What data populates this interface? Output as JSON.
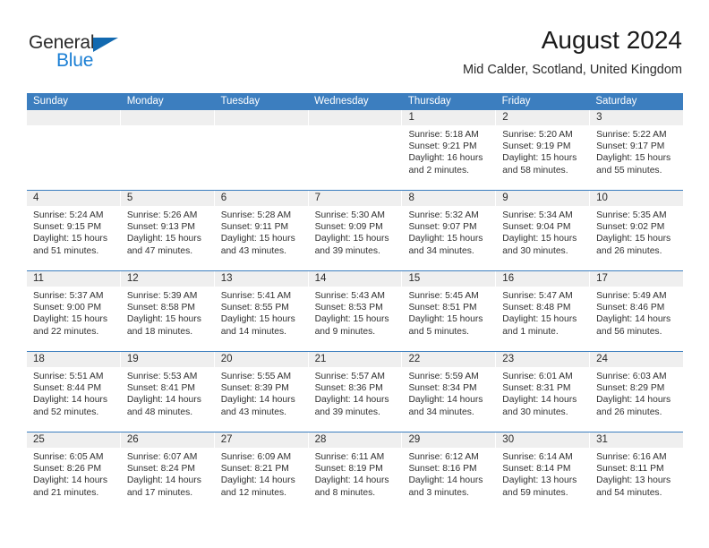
{
  "brand": {
    "name_top": "General",
    "name_bottom": "Blue",
    "triangle_color": "#1269b0",
    "blue_color": "#1b7fd4"
  },
  "header": {
    "title": "August 2024",
    "subtitle": "Mid Calder, Scotland, United Kingdom"
  },
  "theme": {
    "header_blue": "#3c7ebf",
    "day_band_gray": "#efefef",
    "text": "#303030"
  },
  "weekdays": [
    "Sunday",
    "Monday",
    "Tuesday",
    "Wednesday",
    "Thursday",
    "Friday",
    "Saturday"
  ],
  "weeks": [
    [
      {
        "day": "",
        "sunrise": "",
        "sunset": "",
        "daylight_line1": "",
        "daylight_line2": "",
        "empty": true
      },
      {
        "day": "",
        "sunrise": "",
        "sunset": "",
        "daylight_line1": "",
        "daylight_line2": "",
        "empty": true
      },
      {
        "day": "",
        "sunrise": "",
        "sunset": "",
        "daylight_line1": "",
        "daylight_line2": "",
        "empty": true
      },
      {
        "day": "",
        "sunrise": "",
        "sunset": "",
        "daylight_line1": "",
        "daylight_line2": "",
        "empty": true
      },
      {
        "day": "1",
        "sunrise": "Sunrise: 5:18 AM",
        "sunset": "Sunset: 9:21 PM",
        "daylight_line1": "Daylight: 16 hours",
        "daylight_line2": "and 2 minutes."
      },
      {
        "day": "2",
        "sunrise": "Sunrise: 5:20 AM",
        "sunset": "Sunset: 9:19 PM",
        "daylight_line1": "Daylight: 15 hours",
        "daylight_line2": "and 58 minutes."
      },
      {
        "day": "3",
        "sunrise": "Sunrise: 5:22 AM",
        "sunset": "Sunset: 9:17 PM",
        "daylight_line1": "Daylight: 15 hours",
        "daylight_line2": "and 55 minutes."
      }
    ],
    [
      {
        "day": "4",
        "sunrise": "Sunrise: 5:24 AM",
        "sunset": "Sunset: 9:15 PM",
        "daylight_line1": "Daylight: 15 hours",
        "daylight_line2": "and 51 minutes."
      },
      {
        "day": "5",
        "sunrise": "Sunrise: 5:26 AM",
        "sunset": "Sunset: 9:13 PM",
        "daylight_line1": "Daylight: 15 hours",
        "daylight_line2": "and 47 minutes."
      },
      {
        "day": "6",
        "sunrise": "Sunrise: 5:28 AM",
        "sunset": "Sunset: 9:11 PM",
        "daylight_line1": "Daylight: 15 hours",
        "daylight_line2": "and 43 minutes."
      },
      {
        "day": "7",
        "sunrise": "Sunrise: 5:30 AM",
        "sunset": "Sunset: 9:09 PM",
        "daylight_line1": "Daylight: 15 hours",
        "daylight_line2": "and 39 minutes."
      },
      {
        "day": "8",
        "sunrise": "Sunrise: 5:32 AM",
        "sunset": "Sunset: 9:07 PM",
        "daylight_line1": "Daylight: 15 hours",
        "daylight_line2": "and 34 minutes."
      },
      {
        "day": "9",
        "sunrise": "Sunrise: 5:34 AM",
        "sunset": "Sunset: 9:04 PM",
        "daylight_line1": "Daylight: 15 hours",
        "daylight_line2": "and 30 minutes."
      },
      {
        "day": "10",
        "sunrise": "Sunrise: 5:35 AM",
        "sunset": "Sunset: 9:02 PM",
        "daylight_line1": "Daylight: 15 hours",
        "daylight_line2": "and 26 minutes."
      }
    ],
    [
      {
        "day": "11",
        "sunrise": "Sunrise: 5:37 AM",
        "sunset": "Sunset: 9:00 PM",
        "daylight_line1": "Daylight: 15 hours",
        "daylight_line2": "and 22 minutes."
      },
      {
        "day": "12",
        "sunrise": "Sunrise: 5:39 AM",
        "sunset": "Sunset: 8:58 PM",
        "daylight_line1": "Daylight: 15 hours",
        "daylight_line2": "and 18 minutes."
      },
      {
        "day": "13",
        "sunrise": "Sunrise: 5:41 AM",
        "sunset": "Sunset: 8:55 PM",
        "daylight_line1": "Daylight: 15 hours",
        "daylight_line2": "and 14 minutes."
      },
      {
        "day": "14",
        "sunrise": "Sunrise: 5:43 AM",
        "sunset": "Sunset: 8:53 PM",
        "daylight_line1": "Daylight: 15 hours",
        "daylight_line2": "and 9 minutes."
      },
      {
        "day": "15",
        "sunrise": "Sunrise: 5:45 AM",
        "sunset": "Sunset: 8:51 PM",
        "daylight_line1": "Daylight: 15 hours",
        "daylight_line2": "and 5 minutes."
      },
      {
        "day": "16",
        "sunrise": "Sunrise: 5:47 AM",
        "sunset": "Sunset: 8:48 PM",
        "daylight_line1": "Daylight: 15 hours",
        "daylight_line2": "and 1 minute."
      },
      {
        "day": "17",
        "sunrise": "Sunrise: 5:49 AM",
        "sunset": "Sunset: 8:46 PM",
        "daylight_line1": "Daylight: 14 hours",
        "daylight_line2": "and 56 minutes."
      }
    ],
    [
      {
        "day": "18",
        "sunrise": "Sunrise: 5:51 AM",
        "sunset": "Sunset: 8:44 PM",
        "daylight_line1": "Daylight: 14 hours",
        "daylight_line2": "and 52 minutes."
      },
      {
        "day": "19",
        "sunrise": "Sunrise: 5:53 AM",
        "sunset": "Sunset: 8:41 PM",
        "daylight_line1": "Daylight: 14 hours",
        "daylight_line2": "and 48 minutes."
      },
      {
        "day": "20",
        "sunrise": "Sunrise: 5:55 AM",
        "sunset": "Sunset: 8:39 PM",
        "daylight_line1": "Daylight: 14 hours",
        "daylight_line2": "and 43 minutes."
      },
      {
        "day": "21",
        "sunrise": "Sunrise: 5:57 AM",
        "sunset": "Sunset: 8:36 PM",
        "daylight_line1": "Daylight: 14 hours",
        "daylight_line2": "and 39 minutes."
      },
      {
        "day": "22",
        "sunrise": "Sunrise: 5:59 AM",
        "sunset": "Sunset: 8:34 PM",
        "daylight_line1": "Daylight: 14 hours",
        "daylight_line2": "and 34 minutes."
      },
      {
        "day": "23",
        "sunrise": "Sunrise: 6:01 AM",
        "sunset": "Sunset: 8:31 PM",
        "daylight_line1": "Daylight: 14 hours",
        "daylight_line2": "and 30 minutes."
      },
      {
        "day": "24",
        "sunrise": "Sunrise: 6:03 AM",
        "sunset": "Sunset: 8:29 PM",
        "daylight_line1": "Daylight: 14 hours",
        "daylight_line2": "and 26 minutes."
      }
    ],
    [
      {
        "day": "25",
        "sunrise": "Sunrise: 6:05 AM",
        "sunset": "Sunset: 8:26 PM",
        "daylight_line1": "Daylight: 14 hours",
        "daylight_line2": "and 21 minutes."
      },
      {
        "day": "26",
        "sunrise": "Sunrise: 6:07 AM",
        "sunset": "Sunset: 8:24 PM",
        "daylight_line1": "Daylight: 14 hours",
        "daylight_line2": "and 17 minutes."
      },
      {
        "day": "27",
        "sunrise": "Sunrise: 6:09 AM",
        "sunset": "Sunset: 8:21 PM",
        "daylight_line1": "Daylight: 14 hours",
        "daylight_line2": "and 12 minutes."
      },
      {
        "day": "28",
        "sunrise": "Sunrise: 6:11 AM",
        "sunset": "Sunset: 8:19 PM",
        "daylight_line1": "Daylight: 14 hours",
        "daylight_line2": "and 8 minutes."
      },
      {
        "day": "29",
        "sunrise": "Sunrise: 6:12 AM",
        "sunset": "Sunset: 8:16 PM",
        "daylight_line1": "Daylight: 14 hours",
        "daylight_line2": "and 3 minutes."
      },
      {
        "day": "30",
        "sunrise": "Sunrise: 6:14 AM",
        "sunset": "Sunset: 8:14 PM",
        "daylight_line1": "Daylight: 13 hours",
        "daylight_line2": "and 59 minutes."
      },
      {
        "day": "31",
        "sunrise": "Sunrise: 6:16 AM",
        "sunset": "Sunset: 8:11 PM",
        "daylight_line1": "Daylight: 13 hours",
        "daylight_line2": "and 54 minutes."
      }
    ]
  ]
}
